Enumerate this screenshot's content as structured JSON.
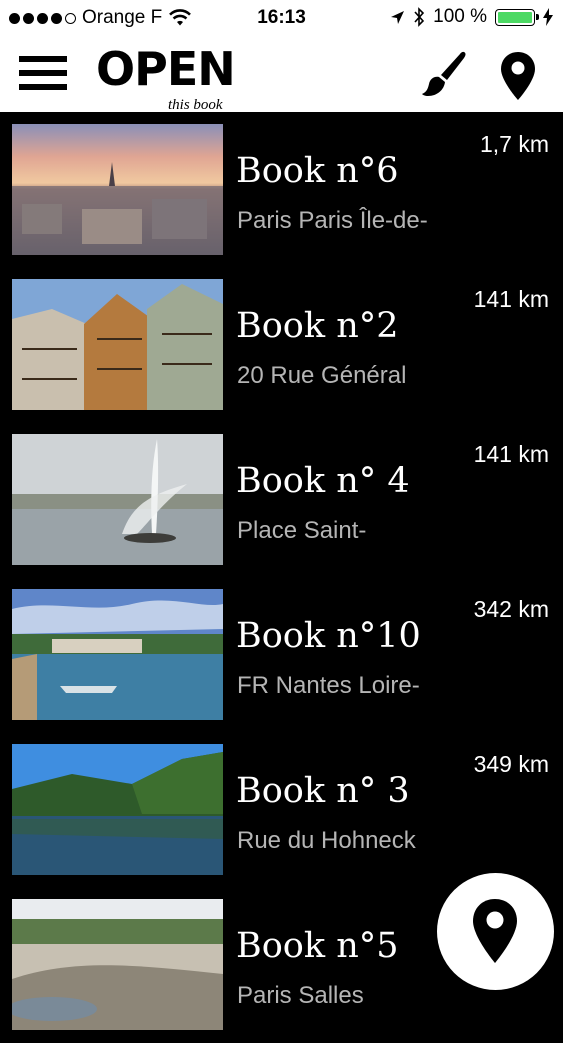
{
  "status": {
    "carrier": "Orange F",
    "time": "16:13",
    "battery_text": "100 %",
    "battery_level": 1.0,
    "battery_color": "#4cd964"
  },
  "header": {
    "logo": "OPEN",
    "logo_sub": "this book",
    "menu_icon": "hamburger-menu-icon",
    "paint_icon": "paintbrush-icon",
    "map_icon": "map-pin-icon"
  },
  "books": [
    {
      "title": "Book n°6",
      "subtitle": "Paris Paris Île-de-",
      "distance": "1,7 km"
    },
    {
      "title": "Book n°2",
      "subtitle": "20 Rue Général",
      "distance": "141 km"
    },
    {
      "title": "Book n° 4",
      "subtitle": "Place Saint-",
      "distance": "141 km"
    },
    {
      "title": "Book n°10",
      "subtitle": "FR Nantes Loire-",
      "distance": "342 km"
    },
    {
      "title": "Book n° 3",
      "subtitle": "Rue du Hohneck",
      "distance": "349 km"
    },
    {
      "title": "Book n°5",
      "subtitle": "Paris Salles",
      "distance": ""
    }
  ],
  "fab": {
    "icon": "map-pin-icon"
  }
}
